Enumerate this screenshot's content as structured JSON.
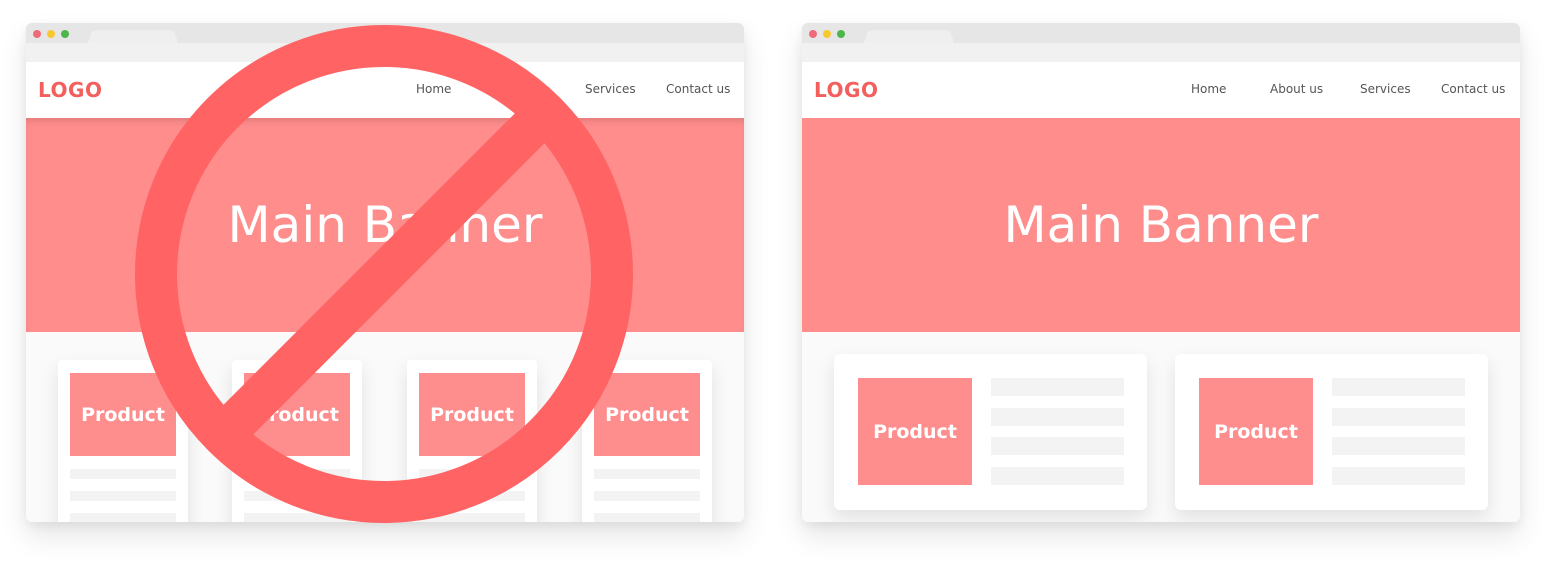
{
  "colors": {
    "accent": "#ff6464",
    "logo": "#f25f5c",
    "banner": "#fe8d8c",
    "product": "#fe8e8e",
    "prohibit": "#ff6363",
    "dot_red": "#f06b7a",
    "dot_yellow": "#f7c92e",
    "dot_green": "#4bb74b"
  },
  "bad_layout": {
    "logo": "LOGO",
    "nav": [
      "Home",
      "Services",
      "Contact us"
    ],
    "banner_title": "Main Banner",
    "products": [
      "Product",
      "Product",
      "Product",
      "Product"
    ],
    "overlay_icon": "prohibited-icon"
  },
  "good_layout": {
    "logo": "LOGO",
    "nav": [
      "Home",
      "About us",
      "Services",
      "Contact us"
    ],
    "banner_title": "Main Banner",
    "products": [
      "Product",
      "Product"
    ]
  }
}
